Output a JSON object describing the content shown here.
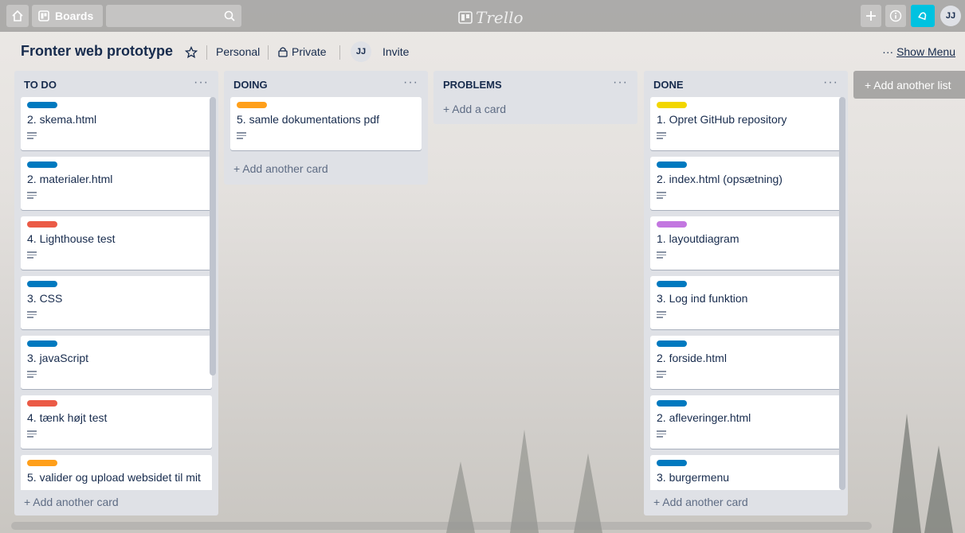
{
  "header": {
    "boards_label": "Boards",
    "logo_text": "Trello",
    "avatar_initials": "JJ"
  },
  "board": {
    "title": "Fronter web prototype",
    "visibility_team": "Personal",
    "visibility_privacy": "Private",
    "member_initials": "JJ",
    "invite_label": "Invite",
    "show_menu_dots": "···",
    "show_menu_label": "Show Menu"
  },
  "colors": {
    "blue": "#0079bf",
    "red": "#eb5a46",
    "orange": "#ff9f1a",
    "yellow": "#f2d600",
    "purple": "#c377e0"
  },
  "lists": [
    {
      "title": "TO DO",
      "menu": "···",
      "add_label": "+ Add another card",
      "cards": [
        {
          "label_color": "blue",
          "text": "2. skema.html"
        },
        {
          "label_color": "blue",
          "text": "2. materialer.html"
        },
        {
          "label_color": "red",
          "text": "4. Lighthouse test"
        },
        {
          "label_color": "blue",
          "text": "3. CSS"
        },
        {
          "label_color": "blue",
          "text": "3. javaScript"
        },
        {
          "label_color": "red",
          "text": "4. tænk højt test"
        },
        {
          "label_color": "orange",
          "text": "5. valider og upload websidet til mit"
        }
      ]
    },
    {
      "title": "DOING",
      "menu": "···",
      "add_label": "+ Add another card",
      "cards": [
        {
          "label_color": "orange",
          "text": "5. samle dokumentations pdf"
        }
      ]
    },
    {
      "title": "PROBLEMS",
      "menu": "···",
      "add_label": "+ Add a card",
      "cards": []
    },
    {
      "title": "DONE",
      "menu": "···",
      "add_label": "+ Add another card",
      "cards": [
        {
          "label_color": "yellow",
          "text": "1. Opret GitHub repository"
        },
        {
          "label_color": "blue",
          "text": "2. index.html (opsætning)"
        },
        {
          "label_color": "purple",
          "text": "1. layoutdiagram"
        },
        {
          "label_color": "blue",
          "text": "3. Log ind funktion"
        },
        {
          "label_color": "blue",
          "text": "2. forside.html"
        },
        {
          "label_color": "blue",
          "text": "2. afleveringer.html"
        },
        {
          "label_color": "blue",
          "text": "3. burgermenu"
        }
      ]
    }
  ],
  "add_list_label": "+ Add another list"
}
